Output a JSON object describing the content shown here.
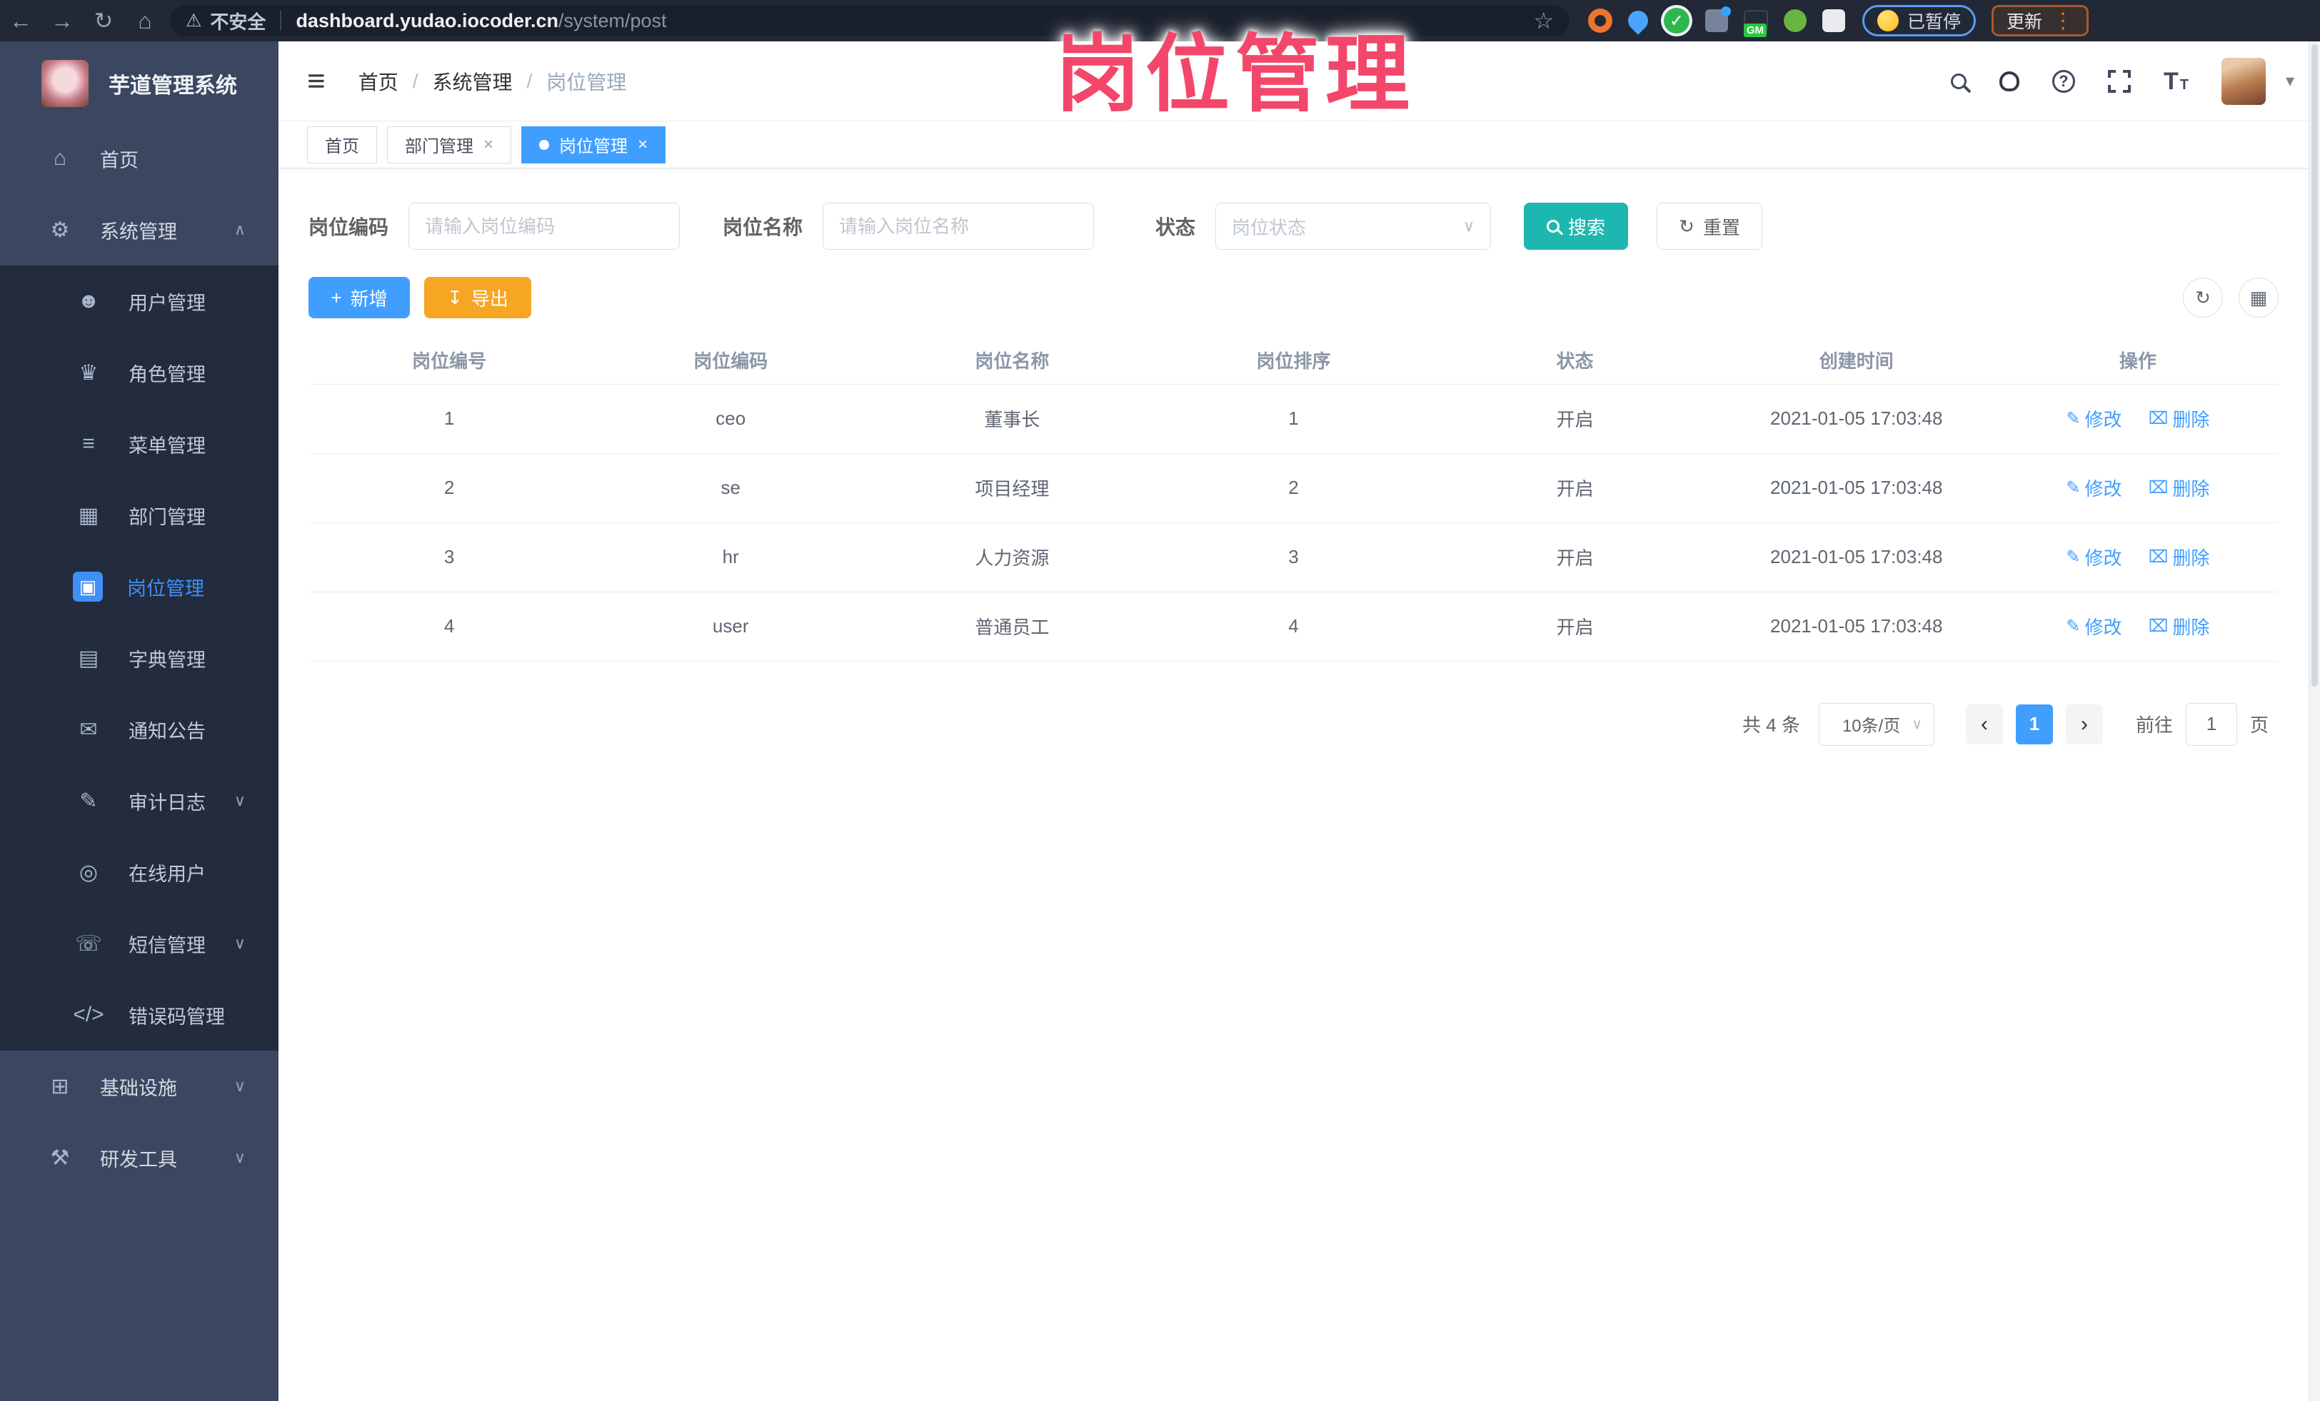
{
  "browser": {
    "security_label": "不安全",
    "url_host": "dashboard.yudao.iocoder.cn",
    "url_path": "/system/post",
    "gm_badge": "GM",
    "check_glyph": "✓",
    "paused_label": "已暂停",
    "update_label": "更新"
  },
  "glyphs": {
    "back": "←",
    "forward": "→",
    "reload": "↻",
    "home": "⌂",
    "warning": "⚠",
    "star": "☆",
    "kebab": "⋮",
    "hamburger": "≡",
    "slash": "/",
    "chevron_up": "∧",
    "chevron_down": "∨",
    "close": "×",
    "question": "?",
    "font_big": "T",
    "font_small": "T",
    "caret_down": "▾",
    "plus": "+",
    "export_arrow": "↧",
    "refresh": "↻",
    "grid": "▦",
    "prev": "‹",
    "next": "›",
    "edit": "✎",
    "delete": "⌧",
    "select_caret": "∨"
  },
  "overlay": {
    "title": "岗位管理"
  },
  "sidebar": {
    "app_title": "芋道管理系统",
    "items": [
      {
        "label": "首页",
        "icon": "⌂"
      },
      {
        "label": "系统管理",
        "icon": "⚙"
      },
      {
        "label": "用户管理",
        "icon": "☻"
      },
      {
        "label": "角色管理",
        "icon": "♛"
      },
      {
        "label": "菜单管理",
        "icon": "≡"
      },
      {
        "label": "部门管理",
        "icon": "▦"
      },
      {
        "label": "岗位管理",
        "icon": "▣"
      },
      {
        "label": "字典管理",
        "icon": "▤"
      },
      {
        "label": "通知公告",
        "icon": "✉"
      },
      {
        "label": "审计日志",
        "icon": "✎"
      },
      {
        "label": "在线用户",
        "icon": "◎"
      },
      {
        "label": "短信管理",
        "icon": "☏"
      },
      {
        "label": "错误码管理",
        "icon": "</>"
      },
      {
        "label": "基础设施",
        "icon": "⊞"
      },
      {
        "label": "研发工具",
        "icon": "⚒"
      }
    ]
  },
  "header": {
    "breadcrumb": [
      "首页",
      "系统管理",
      "岗位管理"
    ]
  },
  "tabs": [
    {
      "label": "首页"
    },
    {
      "label": "部门管理"
    },
    {
      "label": "岗位管理"
    }
  ],
  "filters": {
    "code_label": "岗位编码",
    "code_placeholder": "请输入岗位编码",
    "name_label": "岗位名称",
    "name_placeholder": "请输入岗位名称",
    "status_label": "状态",
    "status_placeholder": "岗位状态",
    "search_label": "搜索",
    "reset_label": "重置"
  },
  "toolbar": {
    "add_label": "新增",
    "export_label": "导出"
  },
  "table": {
    "headers": [
      "岗位编号",
      "岗位编码",
      "岗位名称",
      "岗位排序",
      "状态",
      "创建时间",
      "操作"
    ],
    "rows": [
      [
        "1",
        "ceo",
        "董事长",
        "1",
        "开启",
        "2021-01-05 17:03:48"
      ],
      [
        "2",
        "se",
        "项目经理",
        "2",
        "开启",
        "2021-01-05 17:03:48"
      ],
      [
        "3",
        "hr",
        "人力资源",
        "3",
        "开启",
        "2021-01-05 17:03:48"
      ],
      [
        "4",
        "user",
        "普通员工",
        "4",
        "开启",
        "2021-01-05 17:03:48"
      ]
    ],
    "action_edit": "修改",
    "action_delete": "删除"
  },
  "pagination": {
    "total": "共 4 条",
    "page_size": "10条/页",
    "page": "1",
    "goto_label": "前往",
    "goto_value": "1",
    "page_unit": "页"
  },
  "colors": {
    "accent": "#409eff",
    "search_teal": "#1cb8b0",
    "export_orange": "#f6a623",
    "overlay_pink": "#f2476a",
    "sidebar_bg": "#3b4760",
    "submenu_bg": "#222c3e",
    "chrome_bg": "#222835"
  }
}
